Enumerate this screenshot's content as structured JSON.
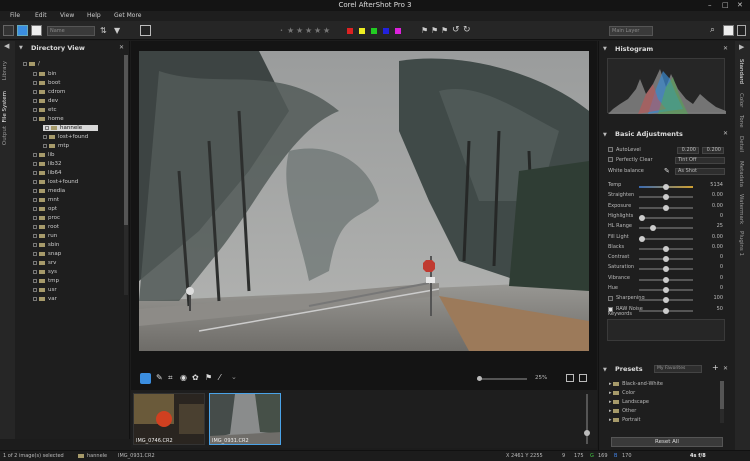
{
  "window": {
    "title": "Corel AfterShot Pro 3",
    "controls": [
      "–",
      "□",
      "✕"
    ]
  },
  "menu": [
    "File",
    "Edit",
    "View",
    "Help",
    "Get More"
  ],
  "toolbar": {
    "name_combo": "Name",
    "layer_combo": "Main Layer"
  },
  "left_tabs": [
    "Library",
    "File System",
    "Output"
  ],
  "directory": {
    "title": "Directory View",
    "items": [
      "/",
      "bin",
      "boot",
      "cdrom",
      "dev",
      "etc",
      "home",
      "hannele",
      "lost+found",
      "mtp",
      "lib",
      "lib32",
      "lib64",
      "lost+found",
      "media",
      "mnt",
      "opt",
      "proc",
      "root",
      "run",
      "sbin",
      "snap",
      "srv",
      "sys",
      "tmp",
      "usr",
      "var"
    ]
  },
  "view": {
    "zoom": "25%"
  },
  "filmstrip": {
    "items": [
      {
        "label": "IMG_0746.CR2"
      },
      {
        "label": "IMG_0931.CR2"
      }
    ]
  },
  "status": {
    "selection": "1 of 2 image(s) selected",
    "folder": "hannele",
    "file": "IMG_0931.CR2",
    "coords": "X 2461  Y 2255",
    "channels": [
      "9",
      "175",
      "G",
      "169",
      "B",
      "170"
    ],
    "site": "4s f/8"
  },
  "histogram": {
    "title": "Histogram"
  },
  "basic": {
    "title": "Basic Adjustments",
    "autolevel": {
      "label": "AutoLevel",
      "v1": "0.200",
      "v2": "0.200"
    },
    "perfectly_clear": {
      "label": "Perfectly Clear",
      "value": "Tint Off"
    },
    "white_balance": {
      "label": "White balance",
      "value": "As Shot"
    },
    "sliders": [
      {
        "label": "Temp",
        "value": "5134",
        "level": 0.5
      },
      {
        "label": "Straighten",
        "value": "0.00",
        "level": 0.5
      },
      {
        "label": "Exposure",
        "value": "0.00",
        "level": 0.5
      },
      {
        "label": "Highlights",
        "value": "0",
        "level": 0.05
      },
      {
        "label": "HL Range",
        "value": "25",
        "level": 0.25
      },
      {
        "label": "Fill Light",
        "value": "0.00",
        "level": 0.05
      },
      {
        "label": "Blacks",
        "value": "0.00",
        "level": 0.5
      },
      {
        "label": "Contrast",
        "value": "0",
        "level": 0.5
      },
      {
        "label": "Saturation",
        "value": "0",
        "level": 0.5
      },
      {
        "label": "Vibrance",
        "value": "0",
        "level": 0.5
      },
      {
        "label": "Hue",
        "value": "0",
        "level": 0.5
      },
      {
        "label": "Sharpening",
        "value": "100",
        "level": 0.5
      },
      {
        "label": "RAW Noise",
        "value": "50",
        "level": 0.5
      }
    ],
    "keywords": "Keywords"
  },
  "presets": {
    "title": "Presets",
    "combo": "My Favorites",
    "items": [
      "Black-and-White",
      "Color",
      "Landscape",
      "Other",
      "Portrait"
    ],
    "reset": "Reset All"
  },
  "right_tabs": [
    "Standard",
    "Color",
    "Tone",
    "Detail",
    "Metadata",
    "Watermark",
    "Plugins 1"
  ]
}
